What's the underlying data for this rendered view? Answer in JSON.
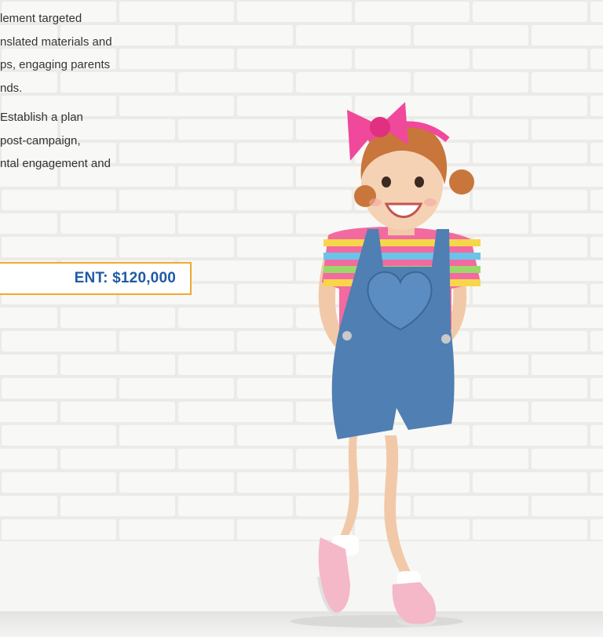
{
  "body_text": {
    "paragraph_1": [
      "lement targeted",
      "nslated materials and",
      "ps, engaging parents",
      "nds."
    ],
    "paragraph_2": [
      " Establish a plan",
      "post-campaign,",
      "ntal engagement and"
    ]
  },
  "investment_label": "ENT: $120,000",
  "colors": {
    "accent_border": "#f0a830",
    "accent_text": "#1f5aa6",
    "body_text": "#333333",
    "wall": "#f2f2f0"
  }
}
